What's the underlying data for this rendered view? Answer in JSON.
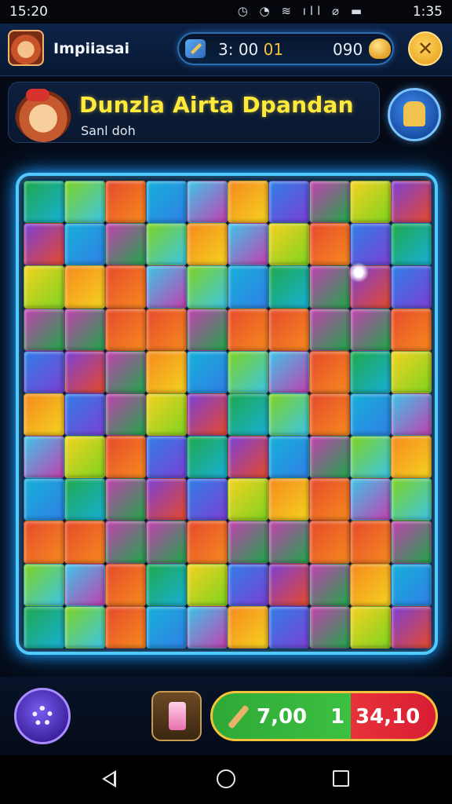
{
  "status_bar": {
    "time": "15:20",
    "icons": "◷ ◔ ≋ ıll ⌀ ▬",
    "clock": "1:35"
  },
  "top_bar": {
    "player_name": "Impiiasai",
    "timer_main": "3: 00",
    "timer_accent": "01",
    "score": "090",
    "close_icon": "close-icon"
  },
  "title_panel": {
    "title": "Dunzla Airta Dpandan",
    "subtitle": "Sanl doh"
  },
  "board": {
    "columns": 10,
    "rows": 11,
    "palette": [
      "#1fa84a",
      "#17b0d8",
      "#2f7fe6",
      "#7b3fd6",
      "#e64a2c",
      "#f68a1f",
      "#f4d21f",
      "#7ed321",
      "#3cc5e8",
      "#c43fb0"
    ]
  },
  "bottom_bar": {
    "value_a": "7,00",
    "value_b": "1",
    "value_c": "34,10"
  },
  "icons": {
    "pencil": "pencil-icon",
    "coin": "coin-icon",
    "hint": "puzzle-hint-icon",
    "settings": "gear-icon",
    "piece_tool": "puzzle-piece-icon"
  }
}
